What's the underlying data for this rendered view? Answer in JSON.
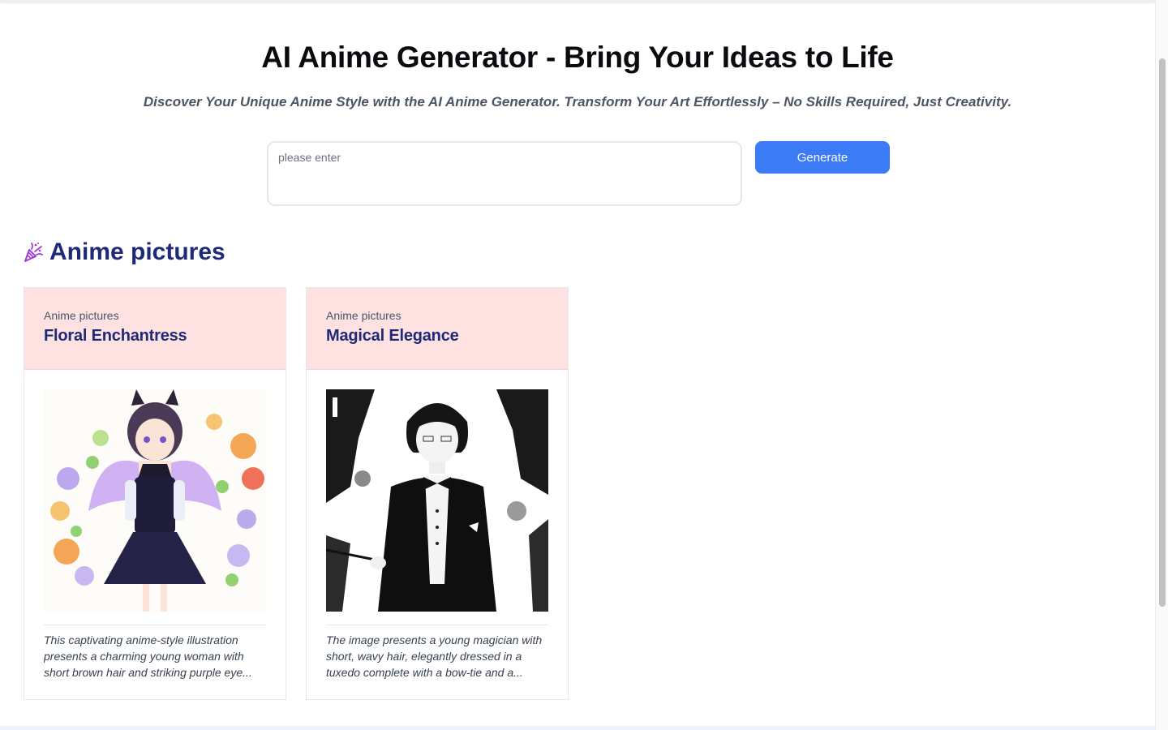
{
  "hero": {
    "title": "AI Anime Generator - Bring Your Ideas to Life",
    "subtitle": "Discover Your Unique Anime Style with the AI Anime Generator. Transform Your Art Effortlessly – No Skills Required, Just Creativity."
  },
  "prompt": {
    "placeholder": "please enter",
    "value": "",
    "generate_label": "Generate"
  },
  "section": {
    "icon": "party-popper-icon",
    "title": "Anime pictures"
  },
  "cards": [
    {
      "category": "Anime pictures",
      "title": "Floral Enchantress",
      "image": "anime-girl-with-wings-and-flowers",
      "description": "This captivating anime-style illustration presents a charming young woman with short brown hair and striking purple eye..."
    },
    {
      "category": "Anime pictures",
      "title": "Magical Elegance",
      "image": "anime-magician-in-tuxedo",
      "description": "The image presents a young magician with short, wavy hair, elegantly dressed in a tuxedo complete with a bow-tie and a..."
    }
  ],
  "colors": {
    "accent": "#3b7cf6",
    "heading": "#1e2a78",
    "card_header": "#fee2e2"
  }
}
